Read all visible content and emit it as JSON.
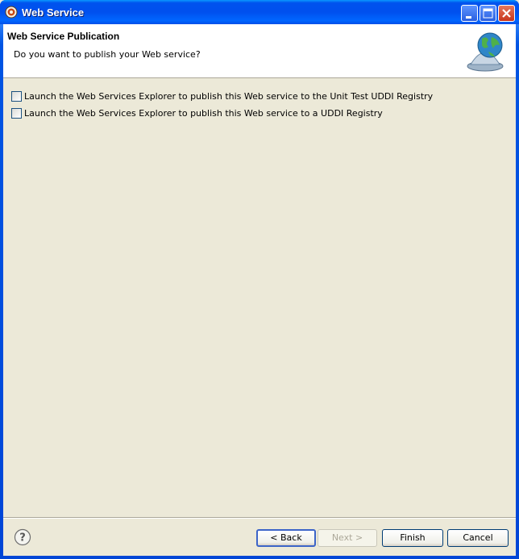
{
  "window": {
    "title": "Web Service",
    "icon": "eclipse-gear-icon"
  },
  "header": {
    "title": "Web Service Publication",
    "description": "Do you want to publish your Web service?",
    "image": "globe-service-bell-icon"
  },
  "options": [
    {
      "label": "Launch the Web Services Explorer to publish this Web service to the Unit Test UDDI Registry",
      "checked": false
    },
    {
      "label": "Launch the Web Services Explorer to publish this Web service to a UDDI Registry",
      "checked": false
    }
  ],
  "footer": {
    "help_icon": "help-icon",
    "back_label": "< Back",
    "next_label": "Next >",
    "finish_label": "Finish",
    "cancel_label": "Cancel"
  }
}
